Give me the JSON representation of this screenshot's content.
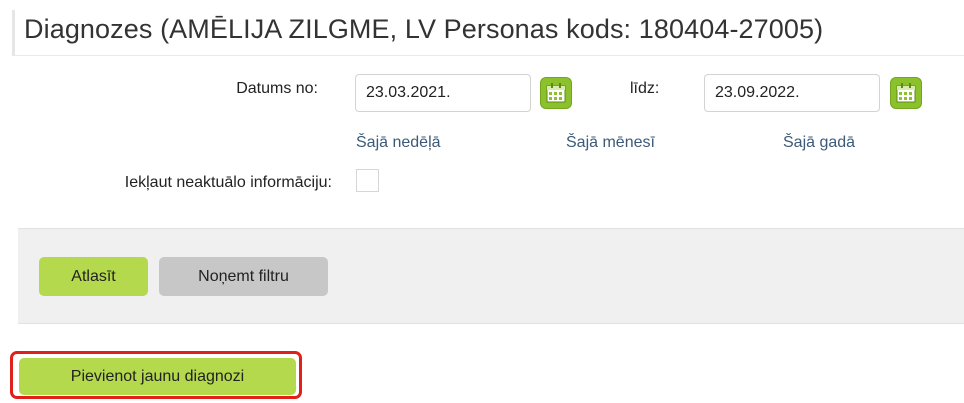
{
  "page": {
    "title": "Diagnozes (AMĒLIJA ZILGME, LV Personas kods: 180404-27005)"
  },
  "filters": {
    "date_from_label": "Datums no:",
    "date_from_value": "23.03.2021.",
    "date_to_label": "līdz:",
    "date_to_value": "23.09.2022.",
    "quick_ranges": [
      "Šajā nedēļā",
      "Šajā mēnesī",
      "Šajā gadā"
    ],
    "include_outdated_label": "Iekļaut neaktuālo informāciju:",
    "include_outdated_checked": false
  },
  "buttons": {
    "select_label": "Atlasīt",
    "clear_filter_label": "Noņemt filtru",
    "add_diagnosis_label": "Pievienot jaunu diagnozi"
  },
  "icons": {
    "calendar": "calendar-icon"
  },
  "colors": {
    "accent_green": "#b5d94d",
    "calendar_green": "#8bc12a",
    "secondary_gray": "#c7c7c7",
    "highlight_red": "#e0201a",
    "link_blue": "#3c5a78"
  }
}
